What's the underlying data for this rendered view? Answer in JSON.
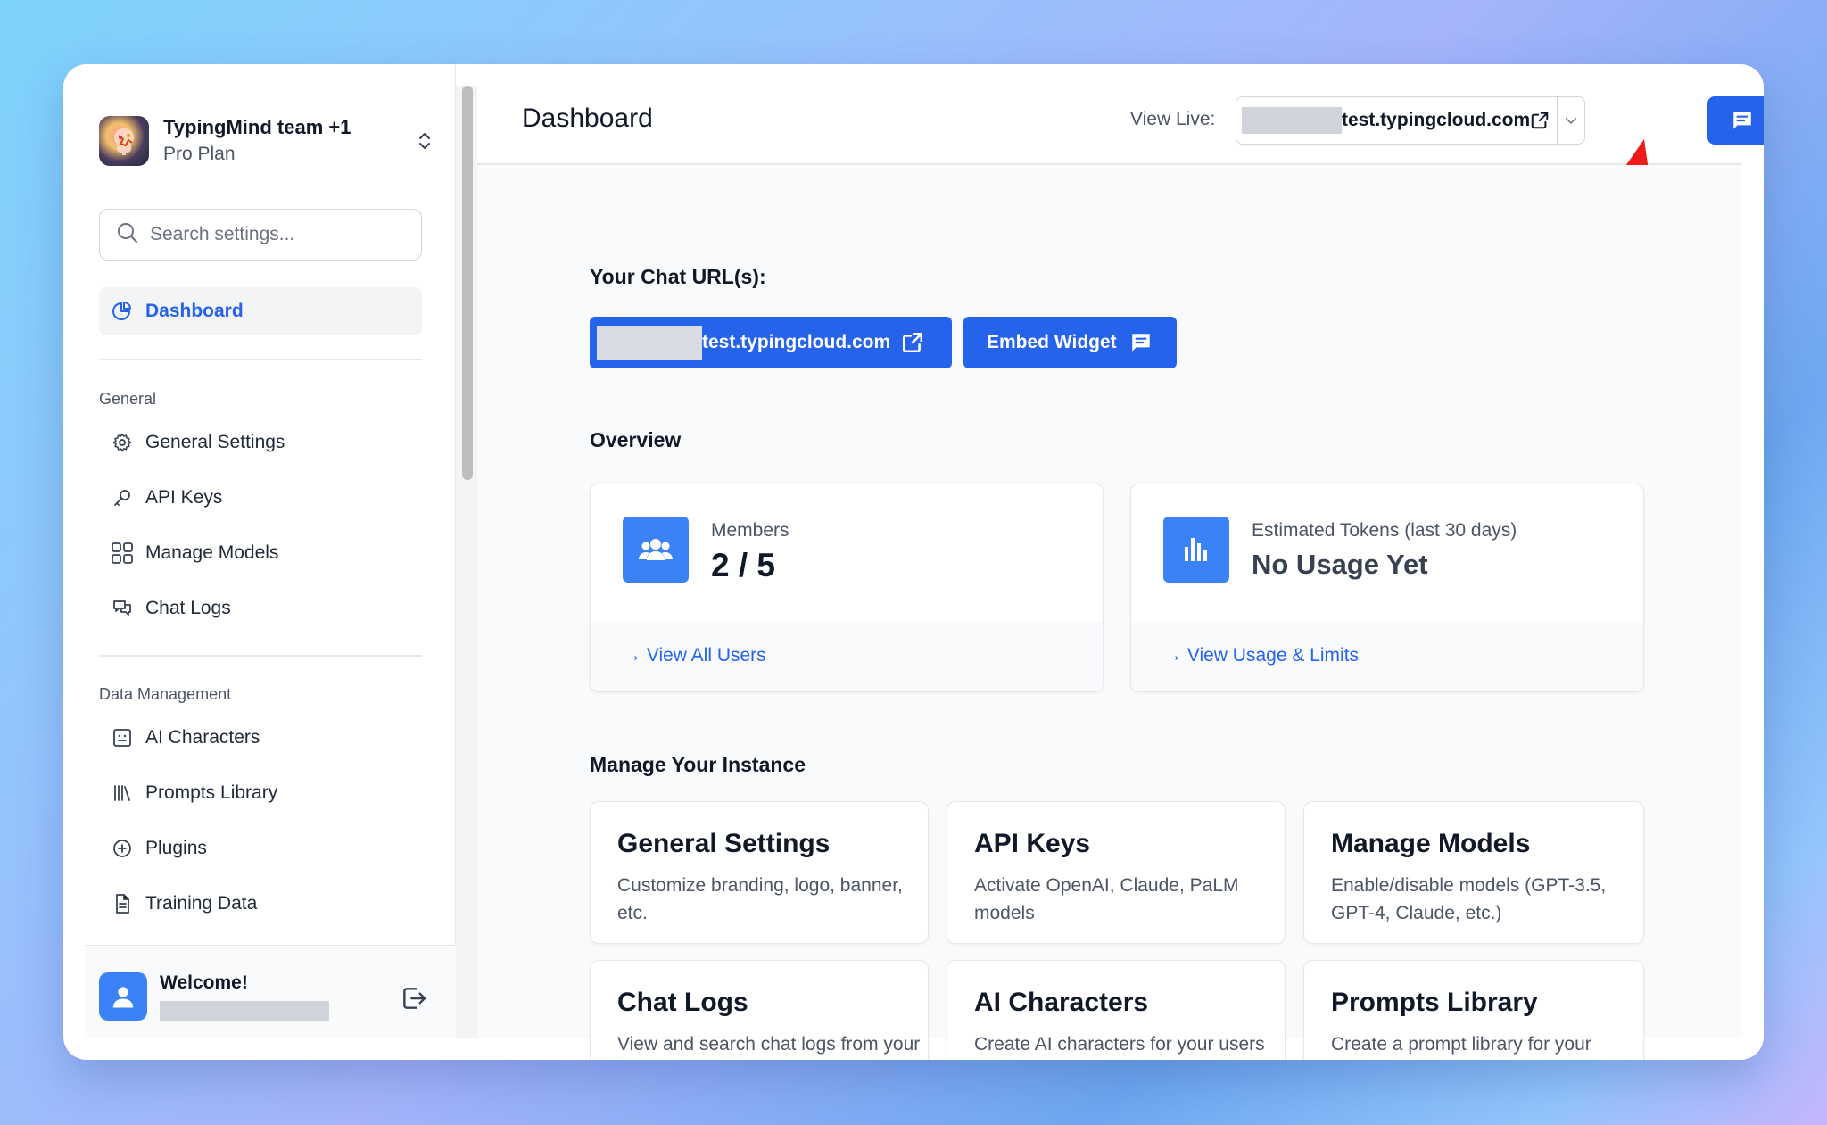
{
  "sidebar": {
    "team_name": "TypingMind team +1",
    "team_plan": "Pro Plan",
    "search_placeholder": "Search settings...",
    "nav_dashboard": "Dashboard",
    "section_general": "General",
    "general_items": [
      {
        "label": "General Settings",
        "icon": "gear-icon"
      },
      {
        "label": "API Keys",
        "icon": "key-icon"
      },
      {
        "label": "Manage Models",
        "icon": "grid-icon"
      },
      {
        "label": "Chat Logs",
        "icon": "chat-icon"
      }
    ],
    "section_data": "Data Management",
    "data_items": [
      {
        "label": "AI Characters",
        "icon": "character-icon"
      },
      {
        "label": "Prompts Library",
        "icon": "library-icon"
      },
      {
        "label": "Plugins",
        "icon": "plus-circle-icon"
      },
      {
        "label": "Training Data",
        "icon": "document-icon"
      }
    ],
    "welcome": "Welcome!"
  },
  "header": {
    "title": "Dashboard",
    "view_live_label": "View Live:",
    "live_url_suffix": "test.typingcloud.com"
  },
  "chat_urls": {
    "heading": "Your Chat URL(s):",
    "url_suffix": "test.typingcloud.com",
    "embed_label": "Embed Widget"
  },
  "overview": {
    "heading": "Overview",
    "members_label": "Members",
    "members_value": "2 / 5",
    "members_link": "→ View All Users",
    "tokens_label": "Estimated Tokens (last 30 days)",
    "tokens_value": "No Usage Yet",
    "tokens_link": "→ View Usage & Limits"
  },
  "manage": {
    "heading": "Manage Your Instance",
    "cards": [
      {
        "title": "General Settings",
        "desc": "Customize branding, logo, banner, etc."
      },
      {
        "title": "API Keys",
        "desc": "Activate OpenAI, Claude, PaLM models"
      },
      {
        "title": "Manage Models",
        "desc": "Enable/disable models (GPT-3.5, GPT-4, Claude, etc.)"
      },
      {
        "title": "Chat Logs",
        "desc": "View and search chat logs from your users"
      },
      {
        "title": "AI Characters",
        "desc": "Create AI characters for your users"
      },
      {
        "title": "Prompts Library",
        "desc": "Create a prompt library for your users"
      }
    ]
  },
  "colors": {
    "accent": "#2563eb",
    "annotation_arrow": "#ef1b1b"
  }
}
